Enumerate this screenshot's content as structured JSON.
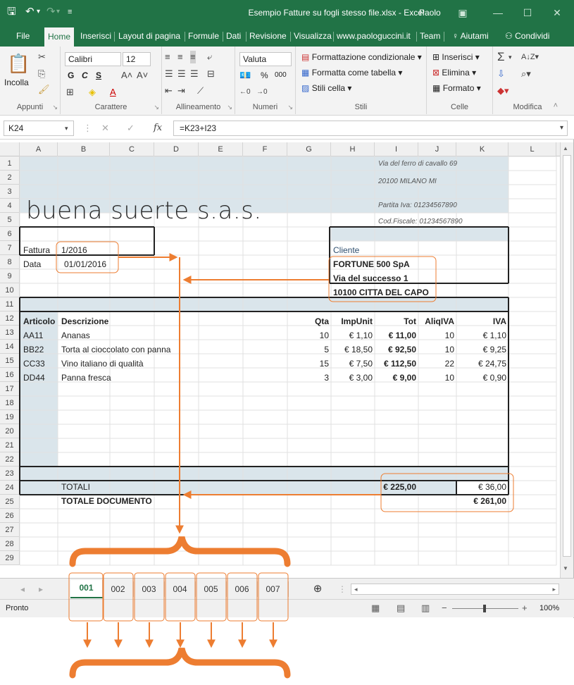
{
  "window": {
    "title": "Esempio Fatture su fogli stesso file.xlsx - Excel",
    "user": "Paolo"
  },
  "ribbon_tabs": [
    "File",
    "Home",
    "Inserisci",
    "Layout di pagina",
    "Formule",
    "Dati",
    "Revisione",
    "Visualizza",
    "www.paologuccini.it",
    "Team"
  ],
  "help": "Aiutami",
  "share": "Condividi",
  "ribbon": {
    "paste": "Incolla",
    "font_name": "Calibri",
    "font_size": "12",
    "bold": "G",
    "italic": "C",
    "underline": "S",
    "number_format": "Valuta",
    "percent": "%",
    "thousands": "000",
    "cond_format": "Formattazione condizionale",
    "format_table": "Formatta come tabella",
    "cell_styles": "Stili cella",
    "insert": "Inserisci",
    "delete": "Elimina",
    "format": "Formato",
    "groups": [
      "Appunti",
      "Carattere",
      "Allineamento",
      "Numeri",
      "Stili",
      "Celle",
      "Modifica"
    ]
  },
  "name_box": "K24",
  "formula": "=K23+I23",
  "columns": [
    "A",
    "B",
    "C",
    "D",
    "E",
    "F",
    "G",
    "H",
    "I",
    "J",
    "K",
    "L"
  ],
  "rows": [
    "1",
    "2",
    "3",
    "4",
    "5",
    "6",
    "7",
    "8",
    "9",
    "10",
    "11",
    "12",
    "13",
    "14",
    "15",
    "16",
    "17",
    "18",
    "19",
    "20",
    "21",
    "22",
    "23",
    "24",
    "25",
    "26",
    "27",
    "28",
    "29"
  ],
  "company": {
    "name": "buena suerte s.a.s.",
    "address": "Via del ferro di cavallo 69",
    "city": "20100 MILANO MI",
    "vat": "Partita Iva: 01234567890",
    "fiscal": "Cod.Fiscale: 01234567890"
  },
  "invoice": {
    "label_number": "Fattura",
    "number": "1/2016",
    "label_date": "Data",
    "date": "01/01/2016"
  },
  "client": {
    "label": "Cliente",
    "name": "FORTUNE 500 SpA",
    "street": "Via del successo 1",
    "city": "10100  CITTA DEL CAPO"
  },
  "table": {
    "headers": [
      "Articolo",
      "Descrizione",
      "Qta",
      "ImpUnit",
      "Tot",
      "AliqIVA",
      "IVA"
    ],
    "rows": [
      [
        "AA11",
        "Ananas",
        "10",
        "€ 1,10",
        "€ 11,00",
        "10",
        "€ 1,10"
      ],
      [
        "BB22",
        "Torta al cioccolato con panna",
        "5",
        "€ 18,50",
        "€ 92,50",
        "10",
        "€ 9,25"
      ],
      [
        "CC33",
        "Vino italiano di qualità",
        "15",
        "€ 7,50",
        "€ 112,50",
        "22",
        "€ 24,75"
      ],
      [
        "DD44",
        "Panna fresca",
        "3",
        "€ 3,00",
        "€ 9,00",
        "10",
        "€ 0,90"
      ]
    ],
    "totals_label": "TOTALI",
    "totals_tot": "€ 225,00",
    "totals_iva": "€ 36,00",
    "doc_label": "TOTALE DOCUMENTO",
    "doc_total": "€ 261,00"
  },
  "sheet_tabs": [
    "001",
    "002",
    "003",
    "004",
    "005",
    "006",
    "007"
  ],
  "status": {
    "ready": "Pronto",
    "zoom": "100%"
  },
  "colors": {
    "excel_green": "#217346",
    "annotation_orange": "#ed7d31",
    "cell_fill": "#dae5eb"
  }
}
